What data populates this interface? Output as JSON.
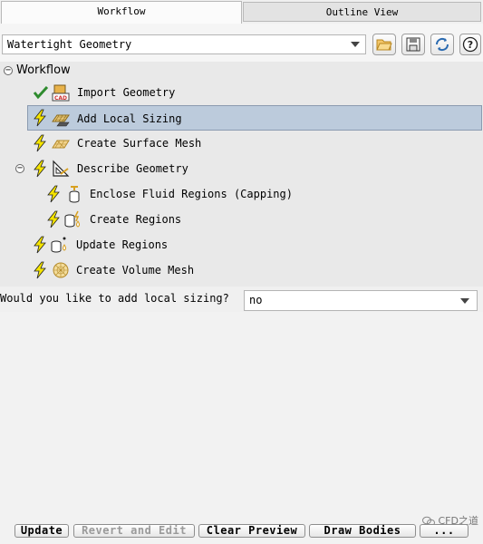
{
  "tabs": [
    {
      "label": "Workflow",
      "active": true
    },
    {
      "label": "Outline View",
      "active": false
    }
  ],
  "toolbar": {
    "workflow_type": "Watertight Geometry",
    "icons": [
      "open-folder-icon",
      "save-icon",
      "refresh-icon",
      "help-icon"
    ]
  },
  "tree": {
    "root_label": "Workflow",
    "items": [
      {
        "label": "Import Geometry",
        "status": "done"
      },
      {
        "label": "Add Local Sizing",
        "status": "pending",
        "selected": true
      },
      {
        "label": "Create Surface Mesh",
        "status": "pending"
      },
      {
        "label": "Describe Geometry",
        "status": "pending"
      },
      {
        "label": "Enclose Fluid Regions (Capping)",
        "status": "pending"
      },
      {
        "label": "Create Regions",
        "status": "pending"
      },
      {
        "label": "Update Regions",
        "status": "pending"
      },
      {
        "label": "Create Volume Mesh",
        "status": "pending"
      }
    ]
  },
  "task_panel": {
    "question": "Would you like to add local sizing?",
    "answer": "no"
  },
  "footer": {
    "update": "Update",
    "revert": "Revert and Edit",
    "clear_preview": "Clear Preview",
    "draw_bodies": "Draw Bodies",
    "more": "..."
  },
  "watermark": "CFD之道",
  "colors": {
    "selection": "#bccbdc",
    "lightning": "#f5e400",
    "check": "#2e8b2e"
  }
}
